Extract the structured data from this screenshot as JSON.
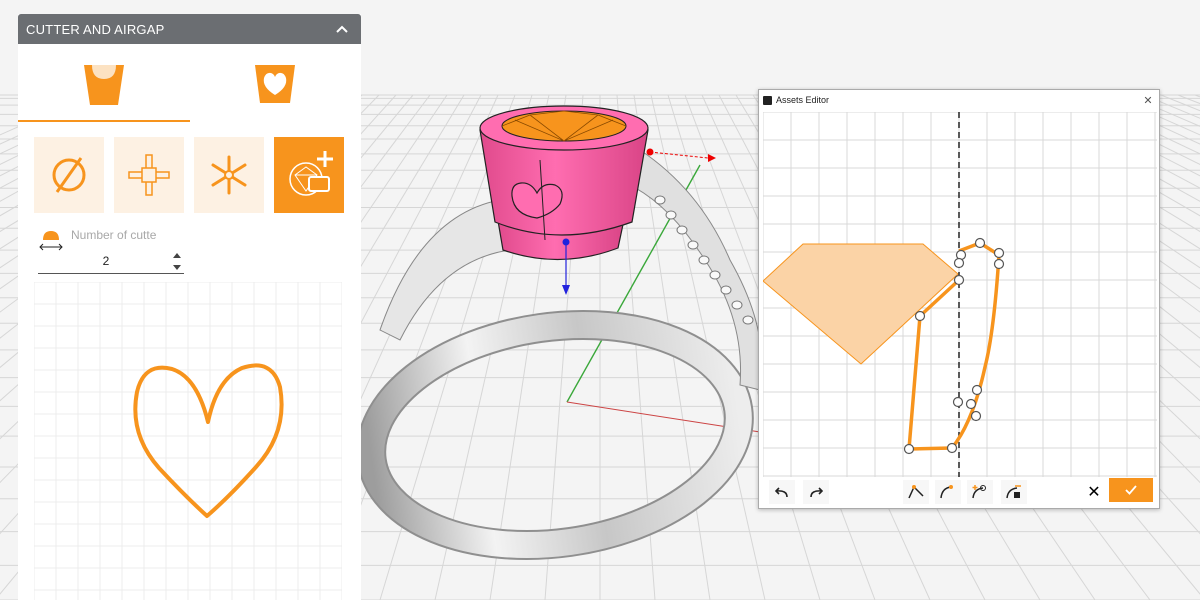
{
  "panel": {
    "title": "CUTTER AND AIRGAP",
    "cutters_label": "Number of cutte",
    "cutters_value": "2"
  },
  "editor": {
    "title": "Assets Editor",
    "close_glyph": "✕",
    "cancel_glyph": "✕"
  },
  "colors": {
    "accent": "#f7941d",
    "header": "#6b6e72",
    "stone_body": "#ff66aa",
    "gem": "#f7941d"
  },
  "icons": [
    "collapse-chevron-icon",
    "cutter-tab-icon",
    "heart-airgap-tab-icon",
    "circle-slash-icon",
    "crosshair-icon",
    "asterisk-icon",
    "add-gem-cutter-icon",
    "half-dome-icon",
    "undo-icon",
    "redo-icon",
    "corner-point-icon",
    "smooth-point-icon",
    "add-point-icon",
    "delete-point-icon",
    "close-icon",
    "check-icon"
  ]
}
